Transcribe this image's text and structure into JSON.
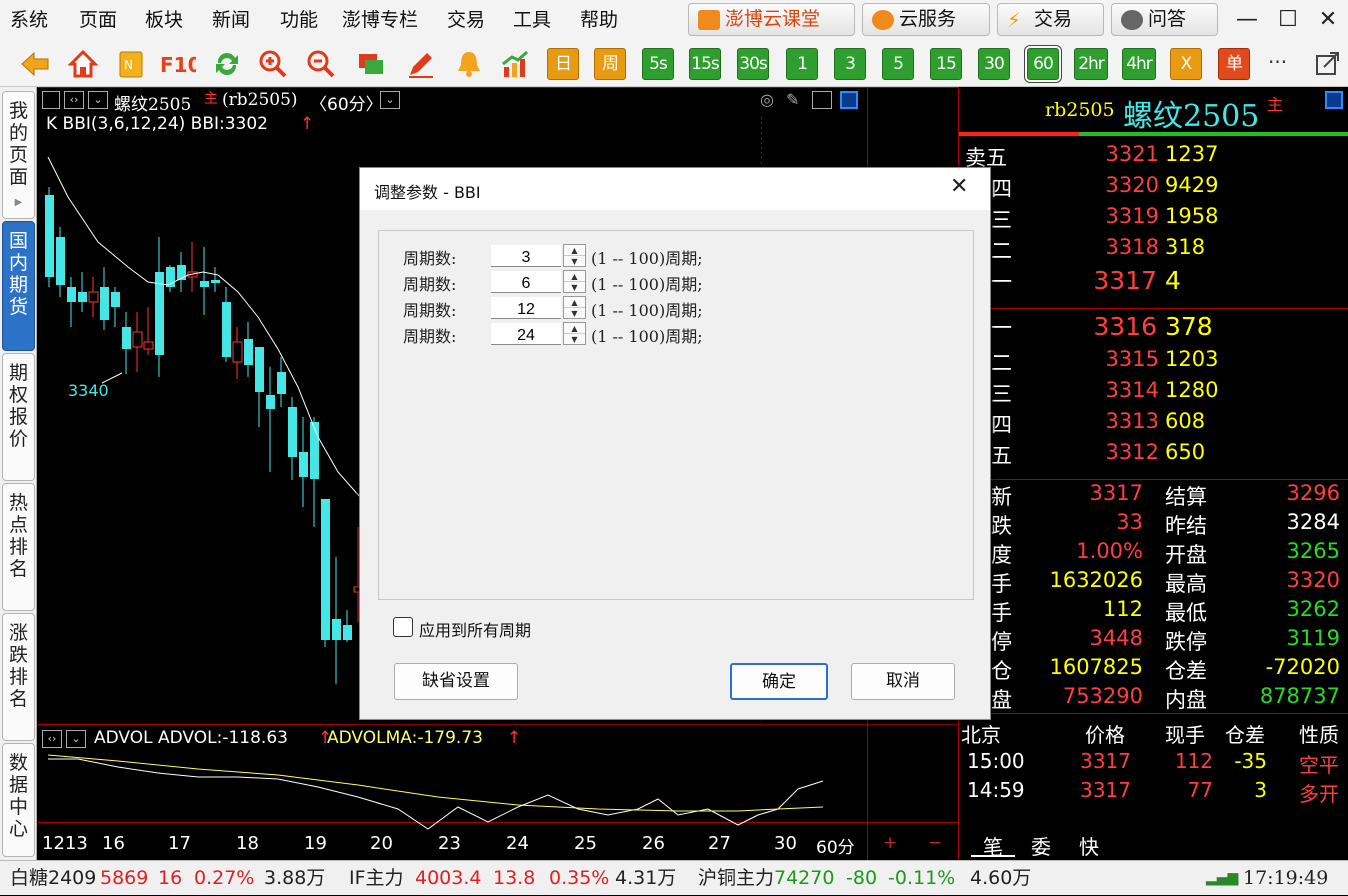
{
  "menu": [
    "系统",
    "页面",
    "板块",
    "新闻",
    "功能",
    "澎博专栏",
    "交易",
    "工具",
    "帮助"
  ],
  "top_buttons": {
    "cloud_class": "澎博云课堂",
    "cloud_service": "云服务",
    "trade": "交易",
    "qa": "问答"
  },
  "window_controls": {
    "minimize": "—",
    "maximize": "☐",
    "close": "✕"
  },
  "period_buttons": [
    "日",
    "周",
    "5s",
    "15s",
    "30s",
    "1",
    "3",
    "5",
    "15",
    "30",
    "60",
    "2hr",
    "4hr",
    "X",
    "单"
  ],
  "period_selected": "60",
  "toolbar_more": "···",
  "sidebar_tabs": [
    {
      "label": "我的页面",
      "active": false
    },
    {
      "label": "国内期货",
      "active": true
    },
    {
      "label": "期权报价",
      "active": false
    },
    {
      "label": "热点排名",
      "active": false
    },
    {
      "label": "涨跌排名",
      "active": false
    },
    {
      "label": "数据中心",
      "active": false
    }
  ],
  "chart": {
    "header_name": "螺纹2505",
    "header_main": "主",
    "header_code": "(rb2505)",
    "header_period": "〈60分〉",
    "indicator_line": "K BBI(3,6,12,24) BBI:3302",
    "indicator_arrow": "↑",
    "low_label": "3340",
    "sub_indicator_name": "ADVOL ADVOL:-118.63",
    "sub_indicator_arrow1": "↑",
    "sub_indicator_ma": "ADVOLMA:-179.73",
    "sub_indicator_arrow2": "↑",
    "x_labels": [
      "1213",
      "16",
      "17",
      "18",
      "19",
      "20",
      "23",
      "24",
      "25",
      "26",
      "27",
      "30"
    ],
    "period_label": "60分",
    "zoom_in": "+",
    "zoom_out": "−",
    "colors": {
      "up": "#ff3333",
      "down": "#44e6e6",
      "ma": "#ffffff",
      "advolma": "#ffff66"
    }
  },
  "quote": {
    "code": "rb2505",
    "name": "螺纹2505",
    "main": "主",
    "asks": [
      {
        "label": "卖五",
        "price": "3321",
        "vol": "1237"
      },
      {
        "label": "四",
        "price": "3320",
        "vol": "9429"
      },
      {
        "label": "三",
        "price": "3319",
        "vol": "1958"
      },
      {
        "label": "二",
        "price": "3318",
        "vol": "318"
      },
      {
        "label": "一",
        "price": "3317",
        "vol": "4"
      }
    ],
    "bids": [
      {
        "label": "一",
        "price": "3316",
        "vol": "378"
      },
      {
        "label": "二",
        "price": "3315",
        "vol": "1203"
      },
      {
        "label": "三",
        "price": "3314",
        "vol": "1280"
      },
      {
        "label": "四",
        "price": "3313",
        "vol": "608"
      },
      {
        "label": "五",
        "price": "3312",
        "vol": "650"
      }
    ],
    "stats": [
      {
        "l1": "新",
        "v1": "3317",
        "c1": "#ff3f3f",
        "l2": "结算",
        "v2": "3296",
        "c2": "#ff3f3f"
      },
      {
        "l1": "跌",
        "v1": "33",
        "c1": "#ff3f3f",
        "l2": "昨结",
        "v2": "3284",
        "c2": "#ffffff"
      },
      {
        "l1": "度",
        "v1": "1.00%",
        "c1": "#ff3f3f",
        "l2": "开盘",
        "v2": "3265",
        "c2": "#22dd22"
      },
      {
        "l1": "手",
        "v1": "1632026",
        "c1": "#ffff00",
        "l2": "最高",
        "v2": "3320",
        "c2": "#ff3f3f"
      },
      {
        "l1": "手",
        "v1": "112",
        "c1": "#ffff00",
        "l2": "最低",
        "v2": "3262",
        "c2": "#22dd22"
      },
      {
        "l1": "停",
        "v1": "3448",
        "c1": "#ff3f3f",
        "l2": "跌停",
        "v2": "3119",
        "c2": "#22dd22"
      },
      {
        "l1": "仓",
        "v1": "1607825",
        "c1": "#ffff00",
        "l2": "仓差",
        "v2": "-72020",
        "c2": "#ffff00"
      },
      {
        "l1": "盘",
        "v1": "753290",
        "c1": "#ff3f3f",
        "l2": "内盘",
        "v2": "878737",
        "c2": "#22dd22"
      }
    ],
    "tick_headers": [
      "北京",
      "价格",
      "现手",
      "仓差",
      "性质"
    ],
    "ticks": [
      {
        "time": "15:00",
        "price": "3317",
        "vol": "112",
        "oi": "-35",
        "type": "空平"
      },
      {
        "time": "14:59",
        "price": "3317",
        "vol": "77",
        "oi": "3",
        "type": "多开"
      }
    ],
    "bottom_tabs": [
      "笔",
      "委",
      "快"
    ]
  },
  "statusbar": {
    "items": [
      {
        "name": "白糖2409",
        "price": "5869",
        "chg": "16",
        "pct": "0.27%",
        "vol": "3.88万"
      },
      {
        "name": "IF主力",
        "price": "4003.4",
        "chg": "13.8",
        "pct": "0.35%",
        "vol": "4.31万"
      },
      {
        "name": "沪铜主力",
        "price": "74270",
        "chg": "-80",
        "pct": "-0.11%",
        "vol": "4.60万"
      }
    ],
    "time": "17:19:49"
  },
  "dialog": {
    "title": "调整参数 - BBI",
    "close": "✕",
    "rows": [
      {
        "label": "周期数:",
        "value": "3",
        "range": "(1 -- 100)周期;"
      },
      {
        "label": "周期数:",
        "value": "6",
        "range": "(1 -- 100)周期;"
      },
      {
        "label": "周期数:",
        "value": "12",
        "range": "(1 -- 100)周期;"
      },
      {
        "label": "周期数:",
        "value": "24",
        "range": "(1 -- 100)周期;"
      }
    ],
    "apply_all": "应用到所有周期",
    "default_btn": "缺省设置",
    "ok_btn": "确定",
    "cancel_btn": "取消"
  }
}
